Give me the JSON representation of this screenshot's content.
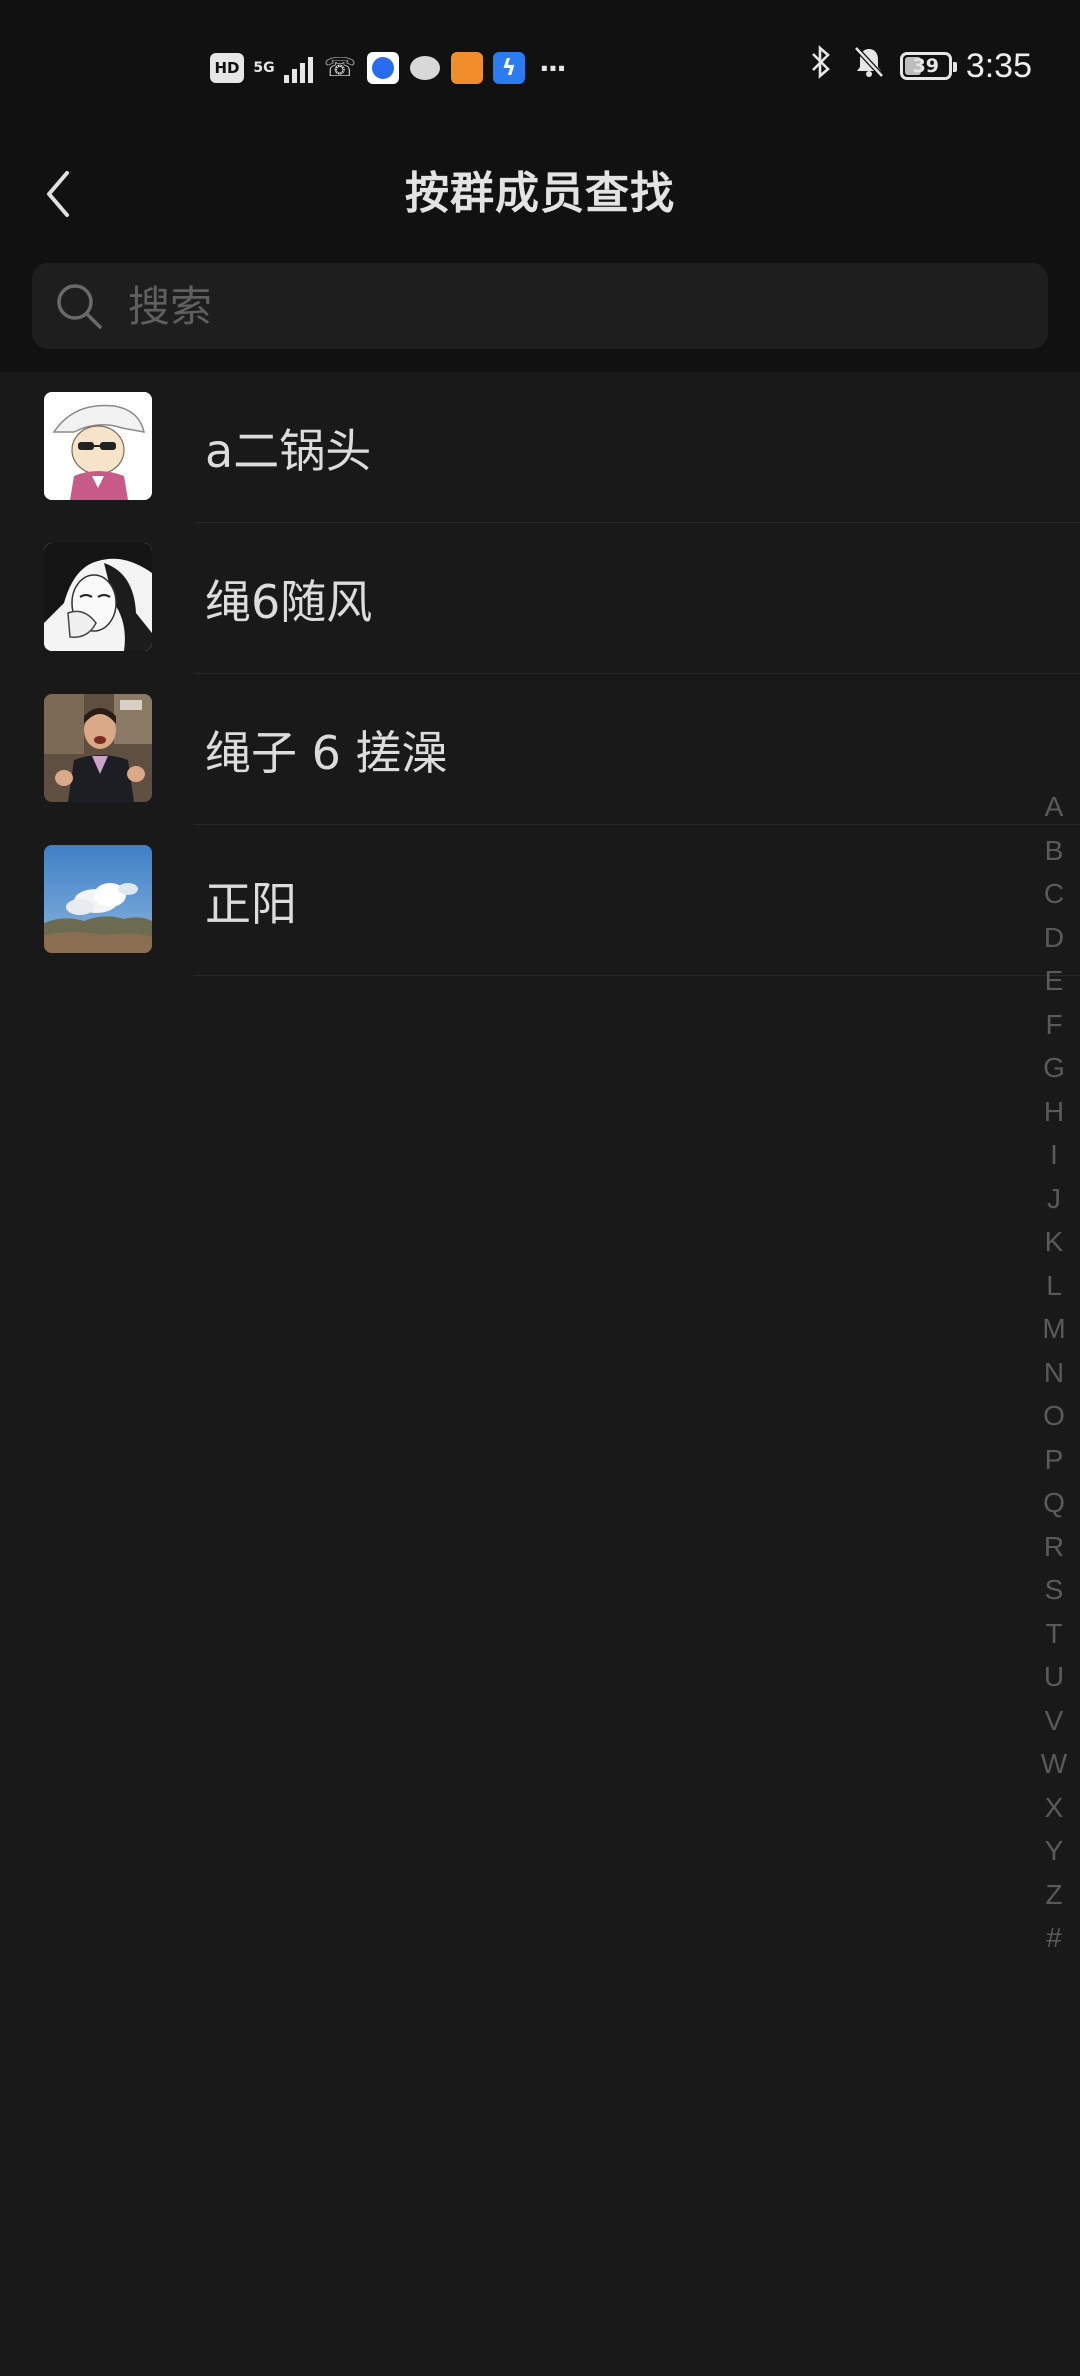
{
  "status_bar": {
    "hd": "HD",
    "network": "5G",
    "battery": "39",
    "time": "3:35",
    "icons": [
      "hd-icon",
      "5g-icon",
      "signal-icon",
      "phone-icon",
      "app-icon",
      "message-icon",
      "game-icon",
      "bolt-icon",
      "more-icon",
      "bluetooth-icon",
      "bell-off-icon",
      "battery-icon"
    ]
  },
  "header": {
    "title": "按群成员查找"
  },
  "search": {
    "placeholder": "搜索"
  },
  "members": [
    {
      "name": "a二锅头"
    },
    {
      "name": "绳6随风"
    },
    {
      "name": "绳子 6 搓澡"
    },
    {
      "name": "正阳"
    }
  ],
  "index_letters": [
    "A",
    "B",
    "C",
    "D",
    "E",
    "F",
    "G",
    "H",
    "I",
    "J",
    "K",
    "L",
    "M",
    "N",
    "O",
    "P",
    "Q",
    "R",
    "S",
    "T",
    "U",
    "V",
    "W",
    "X",
    "Y",
    "Z",
    "#"
  ],
  "colors": {
    "background": "#191919",
    "header": "#111111",
    "text": "#dcdcdc",
    "muted": "#5a5a5a"
  }
}
